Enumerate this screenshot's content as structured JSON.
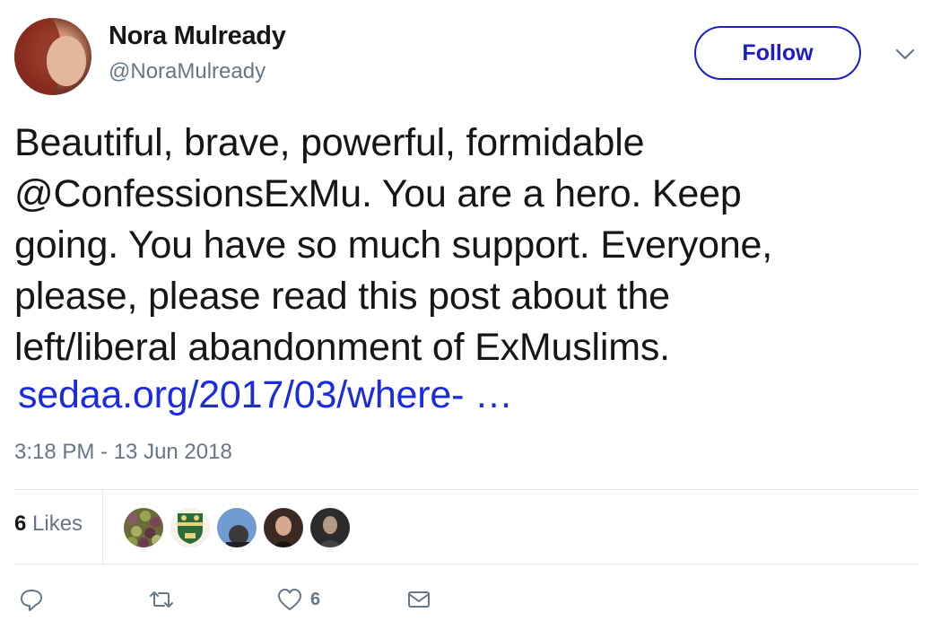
{
  "author": {
    "name": "Nora Mulready",
    "handle": "@NoraMulready",
    "avatar_icon": "profile-photo"
  },
  "header": {
    "follow_label": "Follow",
    "menu_icon": "chevron-down-icon"
  },
  "tweet": {
    "text": "Beautiful, brave, powerful, formidable\n@ConfessionsExMu. You are a hero. Keep\ngoing. You have so much support. Everyone,\nplease, please read this post about the\nleft/liberal abandonment of ExMuslims.",
    "link": "sedaa.org/2017/03/where- …",
    "timestamp": "3:18 PM - 13 Jun 2018"
  },
  "stats": {
    "likes_count": "6",
    "likes_label": "Likes",
    "likers": [
      "liker-olives",
      "liker-crest",
      "liker-man-blue",
      "liker-woman",
      "liker-man-dark"
    ]
  },
  "actions": {
    "reply_icon": "reply-icon",
    "retweet_icon": "retweet-icon",
    "like_icon": "heart-icon",
    "like_count": "6",
    "dm_icon": "envelope-icon"
  },
  "colors": {
    "link": "#1b2be0",
    "follow": "#1d1dc9",
    "secondary_text": "#657786",
    "divider": "#e1e8ed"
  }
}
